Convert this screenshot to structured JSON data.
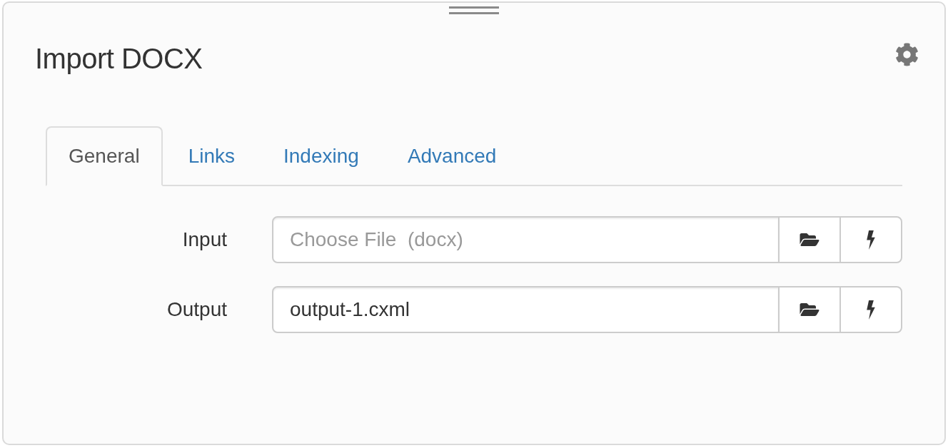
{
  "header": {
    "title": "Import DOCX"
  },
  "tabs": [
    {
      "label": "General",
      "selected": true
    },
    {
      "label": "Links",
      "selected": false
    },
    {
      "label": "Indexing",
      "selected": false
    },
    {
      "label": "Advanced",
      "selected": false
    }
  ],
  "fields": [
    {
      "label": "Input",
      "placeholder": "Choose File  (docx)"
    },
    {
      "label": "Output",
      "value": "output-1.cxml"
    }
  ]
}
